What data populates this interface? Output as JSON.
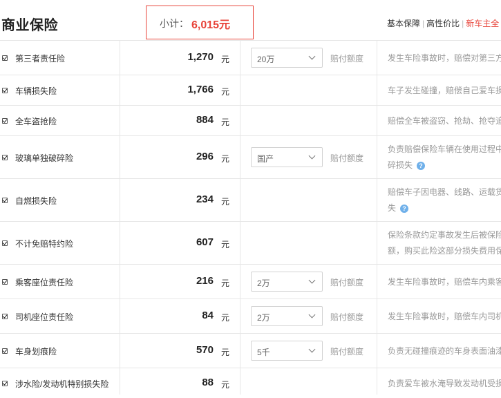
{
  "header": {
    "title": "商业保险",
    "subtotal_label": "小计：",
    "subtotal_value": "6,015元",
    "plans": [
      "基本保障",
      "高性价比",
      "新车主全"
    ],
    "active_plan_index": 2
  },
  "colors": {
    "accent": "#e8443a",
    "help_icon": "#6fb0ea"
  },
  "rows": [
    {
      "name": "第三者责任险",
      "amount": "1,270",
      "unit": "元",
      "select": "20万",
      "amount_label": "赔付额度",
      "desc": [
        "发生车险事故时，赔偿对第三方"
      ]
    },
    {
      "name": "车辆损失险",
      "amount": "1,766",
      "unit": "元",
      "select": "",
      "amount_label": "",
      "desc": [
        "车子发生碰撞，赔偿自己爱车损"
      ]
    },
    {
      "name": "全车盗抢险",
      "amount": "884",
      "unit": "元",
      "select": "",
      "amount_label": "",
      "desc": [
        "赔偿全车被盗窃、抢劫、抢夺追"
      ]
    },
    {
      "name": "玻璃单独破碎险",
      "amount": "296",
      "unit": "元",
      "select": "国产",
      "amount_label": "赔付额度",
      "desc": [
        "负责赔偿保险车辆在使用过程中",
        "碎损失"
      ],
      "help": true
    },
    {
      "name": "自燃损失险",
      "amount": "234",
      "unit": "元",
      "select": "",
      "amount_label": "",
      "desc": [
        "赔偿车子因电器、线路、运载货",
        "失"
      ],
      "help": true
    },
    {
      "name": "不计免赔特约险",
      "amount": "607",
      "unit": "元",
      "select": "",
      "amount_label": "",
      "desc": [
        "保险条款约定事故发生后被保险",
        "额，购买此险这部分损失费用保"
      ]
    },
    {
      "name": "乘客座位责任险",
      "amount": "216",
      "unit": "元",
      "select": "2万",
      "amount_label": "赔付额度",
      "desc": [
        "发生车险事故时，赔偿车内乘客"
      ]
    },
    {
      "name": "司机座位责任险",
      "amount": "84",
      "unit": "元",
      "select": "2万",
      "amount_label": "赔付额度",
      "desc": [
        "发生车险事故时，赔偿车内司机"
      ]
    },
    {
      "name": "车身划痕险",
      "amount": "570",
      "unit": "元",
      "select": "5千",
      "amount_label": "赔付额度",
      "desc": [
        "负责无碰撞痕迹的车身表面油漆"
      ]
    },
    {
      "name": "涉水险/发动机特别损失险",
      "amount": "88",
      "unit": "元",
      "select": "",
      "amount_label": "",
      "desc": [
        "负责爱车被水淹导致发动机受损"
      ]
    }
  ]
}
